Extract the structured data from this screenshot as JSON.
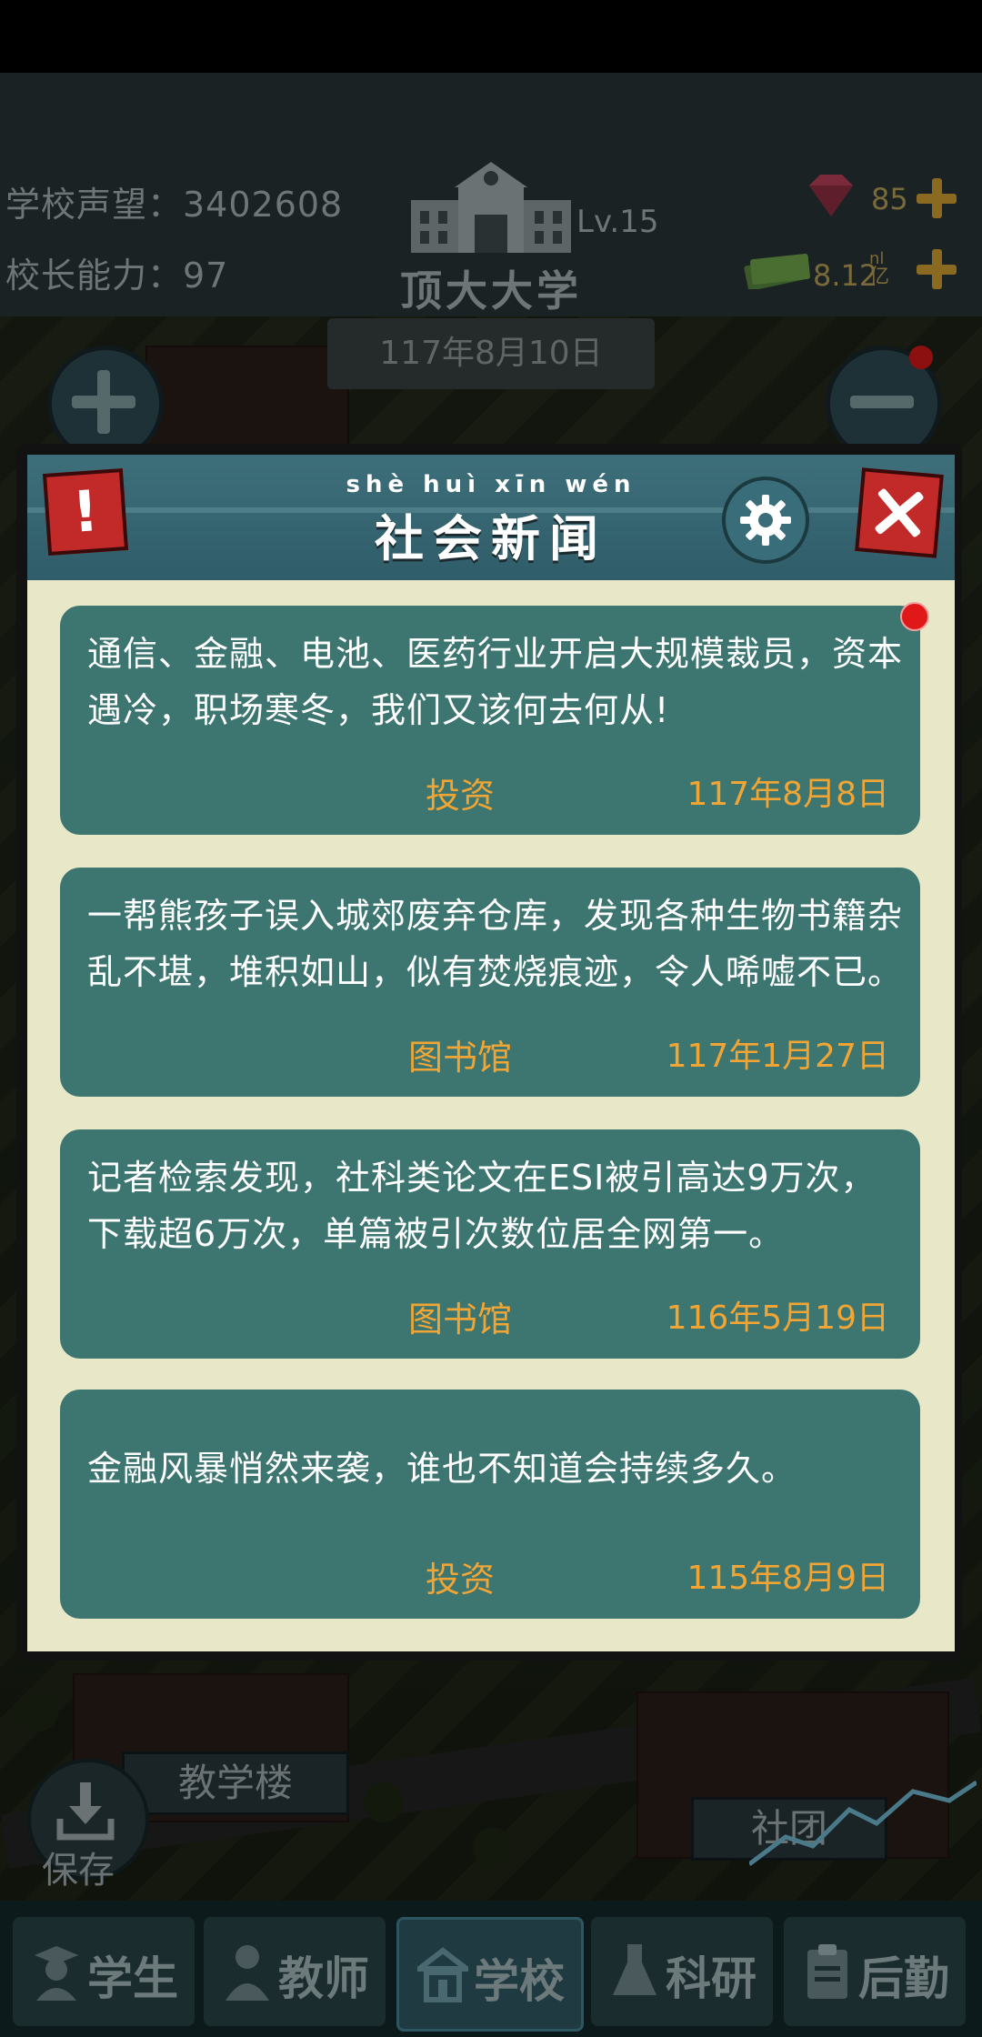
{
  "header": {
    "reputation_label": "学校声望：3402608",
    "ability_label": "校长能力：97",
    "level": "Lv.15",
    "school_name": "顶大大学",
    "gems": "85",
    "money": "8.12",
    "money_unit_top": "nl",
    "money_unit_bottom": "亿",
    "date": "117年8月10日"
  },
  "dialog": {
    "title_pinyin": "shè huì xīn wén",
    "title": "社会新闻",
    "alert_glyph": "!"
  },
  "news": [
    {
      "text": "通信、金融、电池、医药行业开启大规模裁员，资本遇冷，职场寒冬，我们又该何去何从!",
      "category": "投资",
      "date": "117年8月8日"
    },
    {
      "text": "一帮熊孩子误入城郊废弃仓库，发现各种生物书籍杂乱不堪，堆积如山，似有焚烧痕迹，令人唏嘘不已。",
      "category": "图书馆",
      "date": "117年1月27日"
    },
    {
      "text": "记者检索发现，社科类论文在ESI被引高达9万次，下载超6万次，单篇被引次数位居全网第一。",
      "category": "图书馆",
      "date": "116年5月19日"
    },
    {
      "text": "金融风暴悄然来袭，谁也不知道会持续多久。",
      "category": "投资",
      "date": "115年8月9日"
    }
  ],
  "world": {
    "building_label": "教学楼",
    "club_label": "社团",
    "save_label": "保存"
  },
  "nav": {
    "tabs": [
      {
        "label": "学生",
        "icon": "student-icon"
      },
      {
        "label": "教师",
        "icon": "teacher-icon"
      },
      {
        "label": "学校",
        "icon": "school-icon"
      },
      {
        "label": "科研",
        "icon": "flask-icon"
      },
      {
        "label": "后勤",
        "icon": "clipboard-icon"
      }
    ],
    "active": "学校"
  },
  "colors": {
    "card_bg": "#3d7570",
    "accent_orange": "#f0a535",
    "dialog_body": "#e8e8c8",
    "header_teal": "#3d6f7a",
    "close_red": "#c22a2a"
  }
}
